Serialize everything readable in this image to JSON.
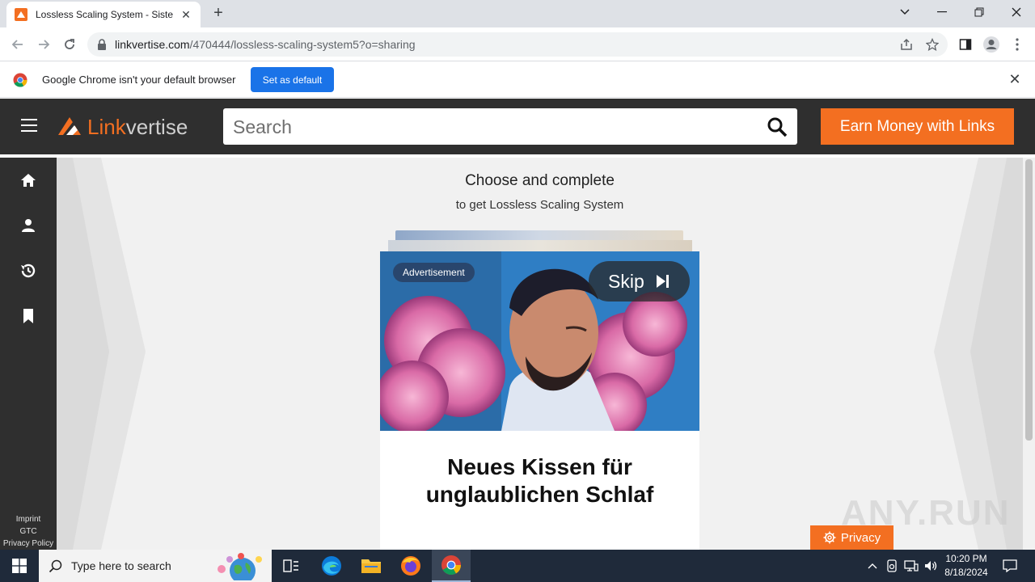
{
  "browser": {
    "tab_title": "Lossless Scaling System - Sistem",
    "url_domain": "linkvertise.com",
    "url_path": "/470444/lossless-scaling-system5?o=sharing"
  },
  "infobar": {
    "message": "Google Chrome isn't your default browser",
    "button": "Set as default"
  },
  "site": {
    "logo_link": "Link",
    "logo_vertise": "vertise",
    "search_placeholder": "Search",
    "earn_button": "Earn Money with Links",
    "footer_links": [
      "Imprint",
      "GTC",
      "Privacy Policy"
    ]
  },
  "main": {
    "heading": "Choose and complete",
    "subheading": "to get Lossless Scaling System",
    "ad_label": "Advertisement",
    "skip_label": "Skip",
    "ad_title_line1": "Neues Kissen für",
    "ad_title_line2": "unglaublichen Schlaf",
    "privacy_button": "Privacy",
    "watermark": "ANY.RUN"
  },
  "taskbar": {
    "search_placeholder": "Type here to search",
    "time": "10:20 PM",
    "date": "8/18/2024"
  },
  "colors": {
    "brand_orange": "#f36f21",
    "header_dark": "#2f2f2f",
    "chrome_blue": "#1a73e8"
  }
}
